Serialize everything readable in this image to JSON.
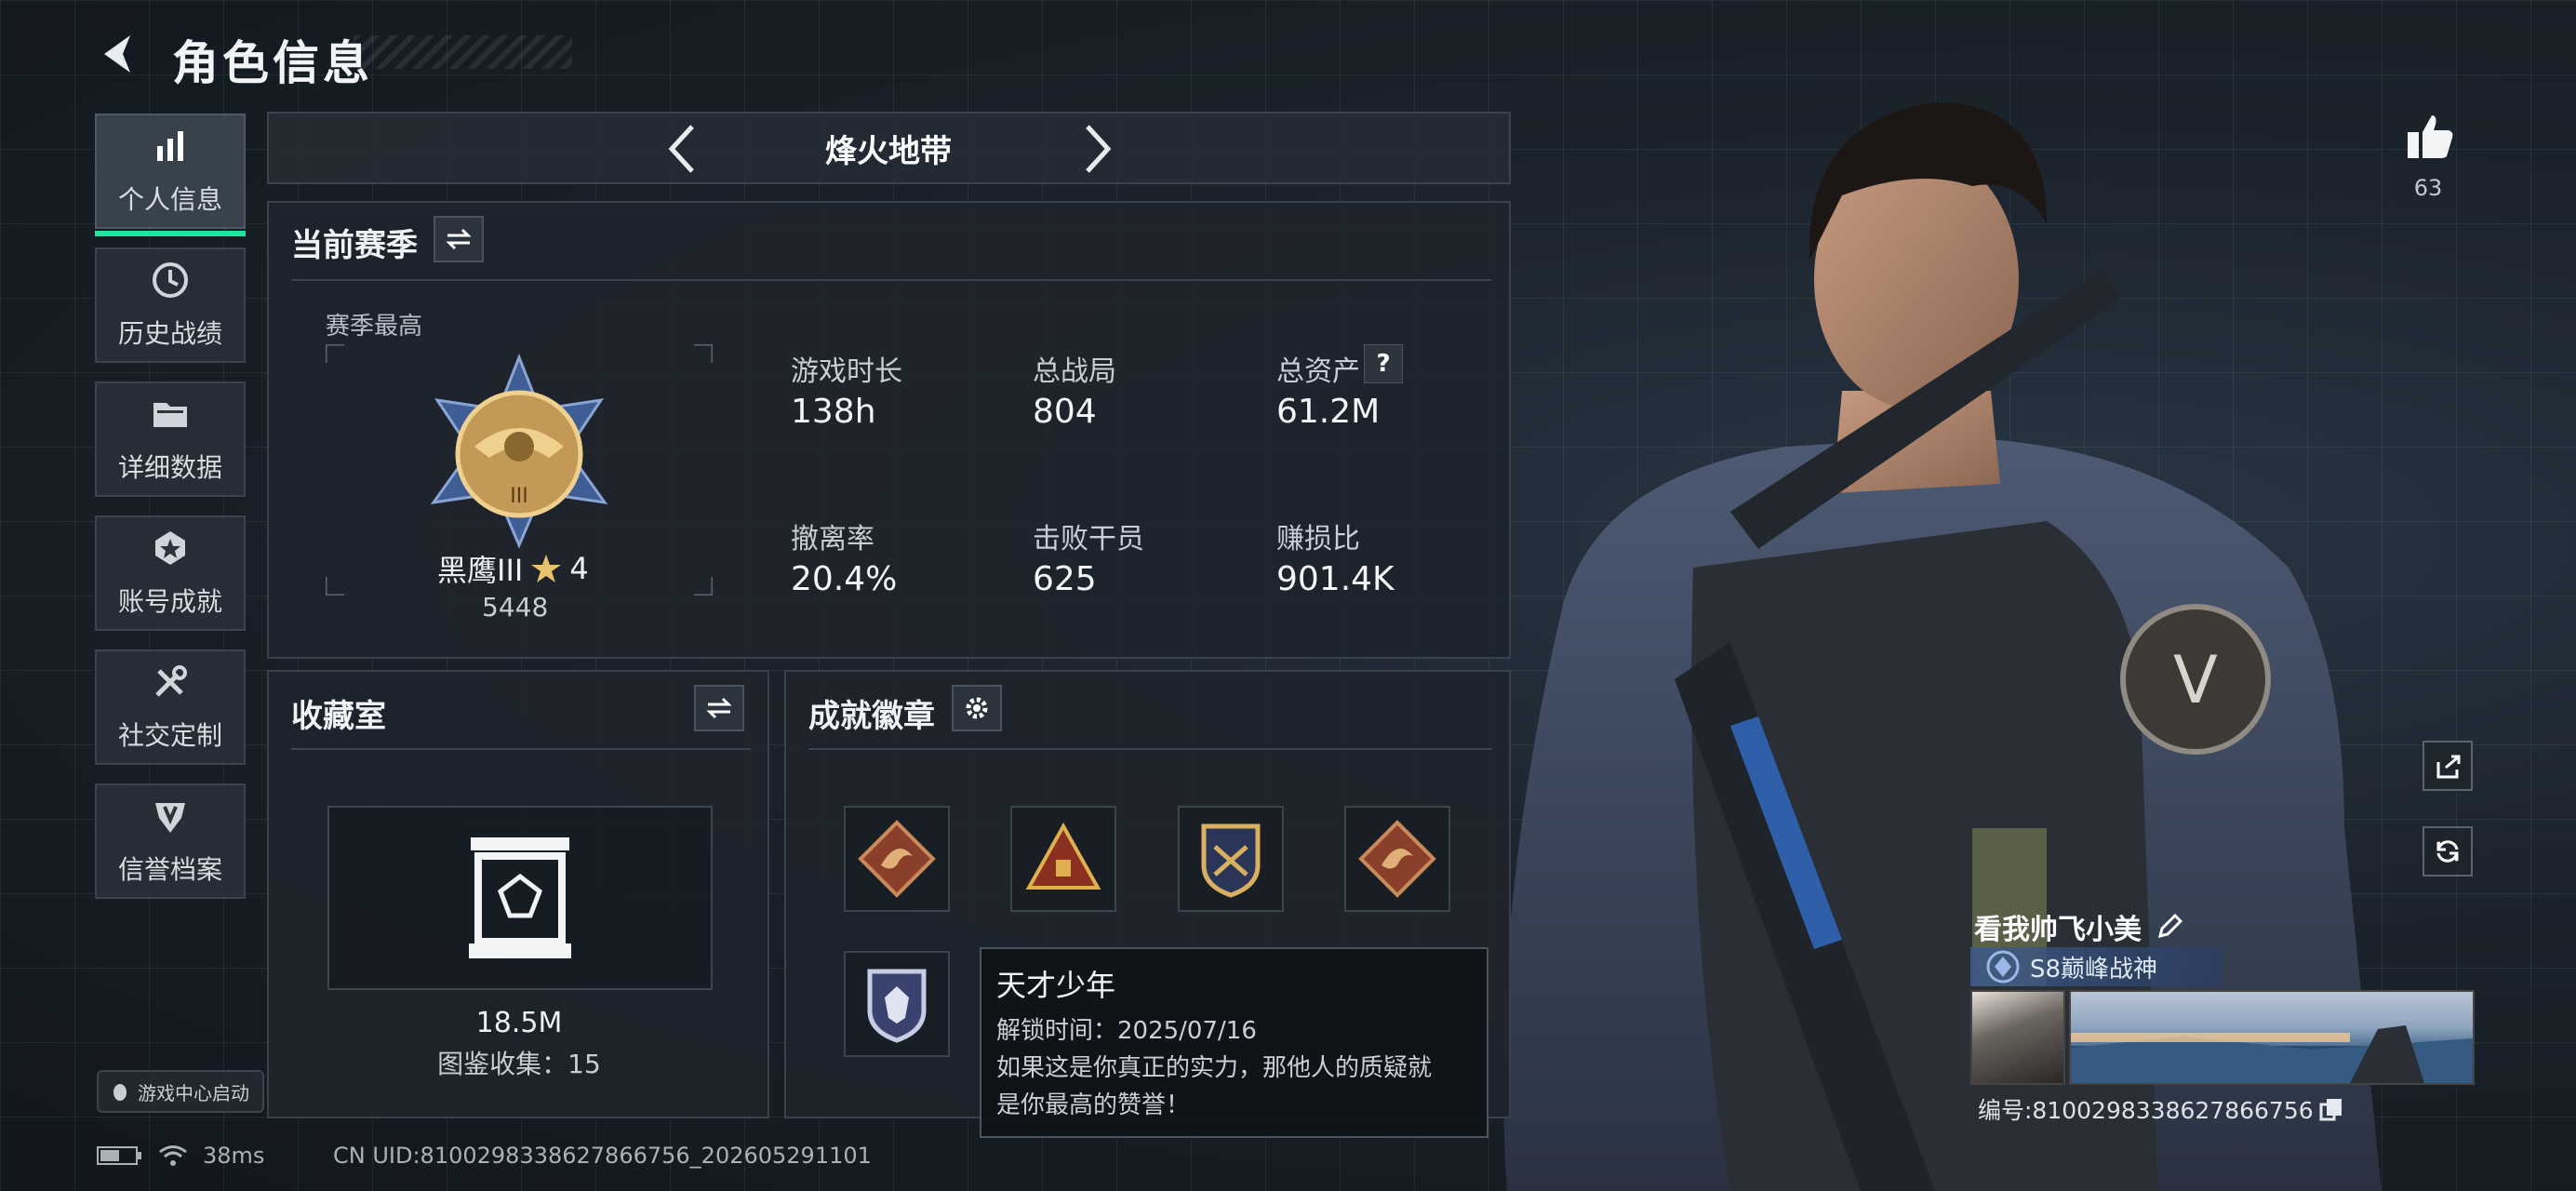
{
  "header": {
    "title": "角色信息"
  },
  "sidebar": {
    "items": [
      {
        "label": "个人信息",
        "icon": "bar-chart-icon",
        "active": true
      },
      {
        "label": "历史战绩",
        "icon": "clock-icon"
      },
      {
        "label": "详细数据",
        "icon": "folder-icon"
      },
      {
        "label": "账号成就",
        "icon": "medal-icon"
      },
      {
        "label": "社交定制",
        "icon": "tools-icon"
      },
      {
        "label": "信誉档案",
        "icon": "shield-icon"
      }
    ],
    "launch_label": "游戏中心启动"
  },
  "mode": {
    "title": "烽火地带"
  },
  "season": {
    "title": "当前赛季",
    "best_label": "赛季最高",
    "rank_name": "黑鹰III",
    "rank_stars": "4",
    "rank_points": "5448",
    "stats": [
      {
        "label": "游戏时长",
        "value": "138h"
      },
      {
        "label": "总战局",
        "value": "804"
      },
      {
        "label": "总资产",
        "value": "61.2M",
        "help": "?"
      },
      {
        "label": "撤离率",
        "value": "20.4%"
      },
      {
        "label": "击败干员",
        "value": "625"
      },
      {
        "label": "赚损比",
        "value": "901.4K"
      }
    ]
  },
  "collection": {
    "title": "收藏室",
    "value": "18.5M",
    "catalog_label": "图鉴收集：15"
  },
  "achievements": {
    "title": "成就徽章",
    "badges": [
      "dragon-badge-icon",
      "pyramid-badge-icon",
      "crest-badge-icon",
      "dragon-badge-icon",
      "wolf-badge-icon"
    ],
    "tooltip": {
      "title": "天才少年",
      "unlock": "解锁时间：2025/07/16",
      "desc_line1": "如果这是你真正的实力，那他人的质疑就",
      "desc_line2": "是你最高的赞誉！"
    }
  },
  "profile": {
    "likes": "63",
    "name": "看我帅飞小美",
    "title_badge": "S8巅峰战神",
    "uid_label": "编号:8100298338627866756"
  },
  "status_bar": {
    "ping": "38ms",
    "cn_uid": "CN UID:8100298338627866756_202605291101"
  },
  "colors": {
    "accent": "#26e0a0",
    "panel": "#1e242c",
    "border": "#38414c"
  }
}
